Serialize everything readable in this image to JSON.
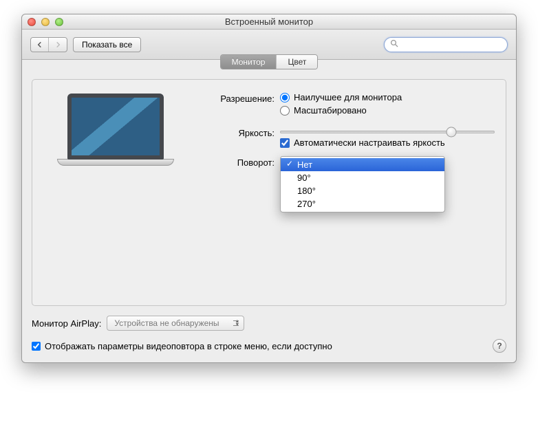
{
  "window": {
    "title": "Встроенный монитор"
  },
  "toolbar": {
    "show_all": "Показать все",
    "search_placeholder": ""
  },
  "tabs": {
    "monitor": "Монитор",
    "color": "Цвет"
  },
  "labels": {
    "resolution": "Разрешение:",
    "brightness": "Яркость:",
    "rotation": "Поворот:",
    "airplay": "Монитор AirPlay:"
  },
  "resolution": {
    "best": "Наилучшее для монитора",
    "scaled": "Масштабировано"
  },
  "brightness": {
    "value_percent": 80,
    "auto_label": "Автоматически настраивать яркость"
  },
  "rotation": {
    "options": [
      "Нет",
      "90°",
      "180°",
      "270°"
    ],
    "selected": "Нет"
  },
  "airplay": {
    "value": "Устройства не обнаружены"
  },
  "show_mirroring": "Отображать параметры видеоповтора в строке меню, если доступно"
}
